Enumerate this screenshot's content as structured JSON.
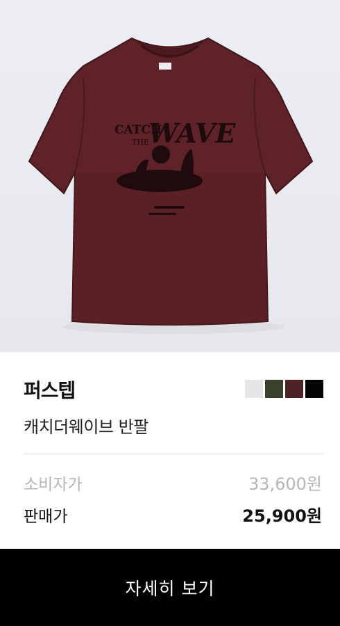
{
  "product": {
    "brand": "퍼스텝",
    "name": "캐치더웨이브 반팔",
    "image_alt": "tshirt-image",
    "shirt_print": {
      "line1": "CATCH",
      "line2": "THE",
      "line3": "WAVE"
    },
    "colors": [
      "#e6e6e6",
      "#39402b",
      "#4e2327",
      "#050505"
    ]
  },
  "pricing": {
    "list_label": "소비자가",
    "list_price": "33,600원",
    "sale_label": "판매가",
    "sale_price": "25,900원"
  },
  "cta": {
    "label": "자세히 보기"
  }
}
